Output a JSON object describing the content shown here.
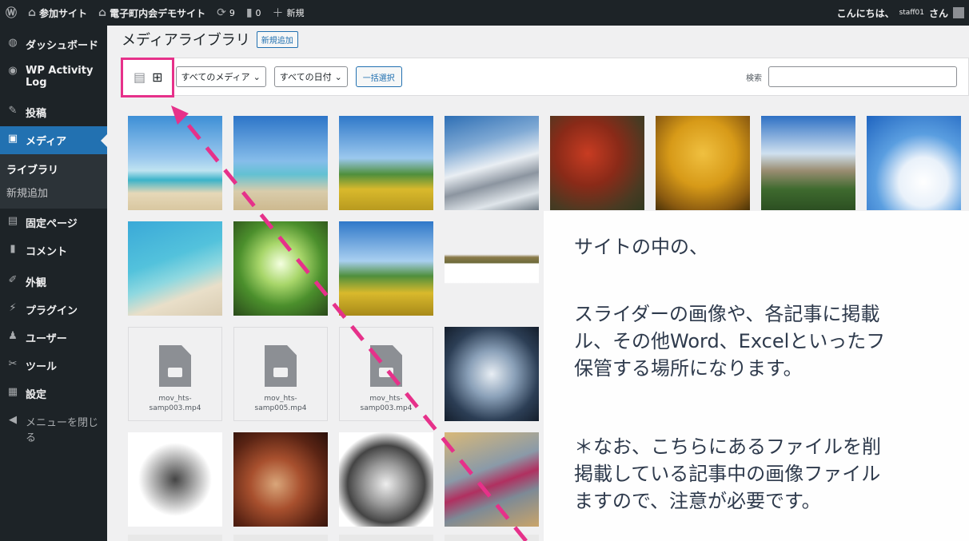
{
  "adminbar": {
    "site": "参加サイト",
    "demo_site": "電子町内会デモサイト",
    "updates": "9",
    "comments": "0",
    "new": "新規",
    "greeting": "こんにちは、",
    "username": "staff01",
    "honorific": "さん"
  },
  "sidebar": {
    "dashboard": "ダッシュボード",
    "activity_log": "WP Activity Log",
    "posts": "投稿",
    "media": "メディア",
    "library": "ライブラリ",
    "add_new": "新規追加",
    "pages": "固定ページ",
    "comments": "コメント",
    "appearance": "外観",
    "plugins": "プラグイン",
    "users": "ユーザー",
    "tools": "ツール",
    "settings": "設定",
    "collapse": "メニューを閉じる"
  },
  "main": {
    "title": "メディアライブラリ",
    "add_new_button": "新規追加",
    "filter_media": "すべてのメディア",
    "filter_date": "すべての日付",
    "bulk_select": "一括選択",
    "search_label": "検索",
    "files": [
      "mov_hts-samp003.mp4",
      "mov_hts-samp005.mp4",
      "mov_hts-samp003.mp4"
    ]
  },
  "overlay": {
    "line1": "サイトの中の、",
    "line2": "スライダーの画像や、各記事に掲載",
    "line3": "ル、その他Word、Excelといったフ",
    "line4": "保管する場所になります。",
    "line5": "＊なお、こちらにあるファイルを削",
    "line6": "掲載している記事中の画像ファイル",
    "line7": "ますので、注意が必要です。"
  },
  "colors": {
    "accent": "#2271b1",
    "highlight": "#e6318a",
    "sidebar_bg": "#1d2327"
  }
}
